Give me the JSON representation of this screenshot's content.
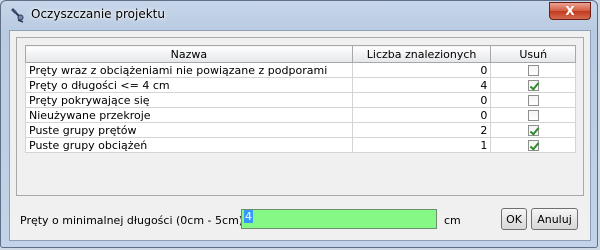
{
  "window": {
    "title": "Oczyszczanie projektu",
    "close_label": "X"
  },
  "table": {
    "headers": [
      "Nazwa",
      "Liczba znalezionych",
      "Usuń"
    ],
    "rows": [
      {
        "name": "Pręty wraz z obciążeniami nie powiązane z podporami",
        "count": "0",
        "remove": false
      },
      {
        "name": "Pręty o długości <= 4 cm",
        "count": "4",
        "remove": true
      },
      {
        "name": "Pręty pokrywające się",
        "count": "0",
        "remove": false
      },
      {
        "name": "Nieużywane przekroje",
        "count": "0",
        "remove": false
      },
      {
        "name": "Puste grupy prętów",
        "count": "2",
        "remove": true
      },
      {
        "name": "Puste grupy obciążeń",
        "count": "1",
        "remove": true
      }
    ]
  },
  "min_length": {
    "label": "Pręty o minimalnej długości (0cm - 5cm)",
    "value": "4",
    "unit": "cm",
    "field_color": "#86f886"
  },
  "buttons": {
    "ok": "OK",
    "cancel": "Anuluj"
  }
}
